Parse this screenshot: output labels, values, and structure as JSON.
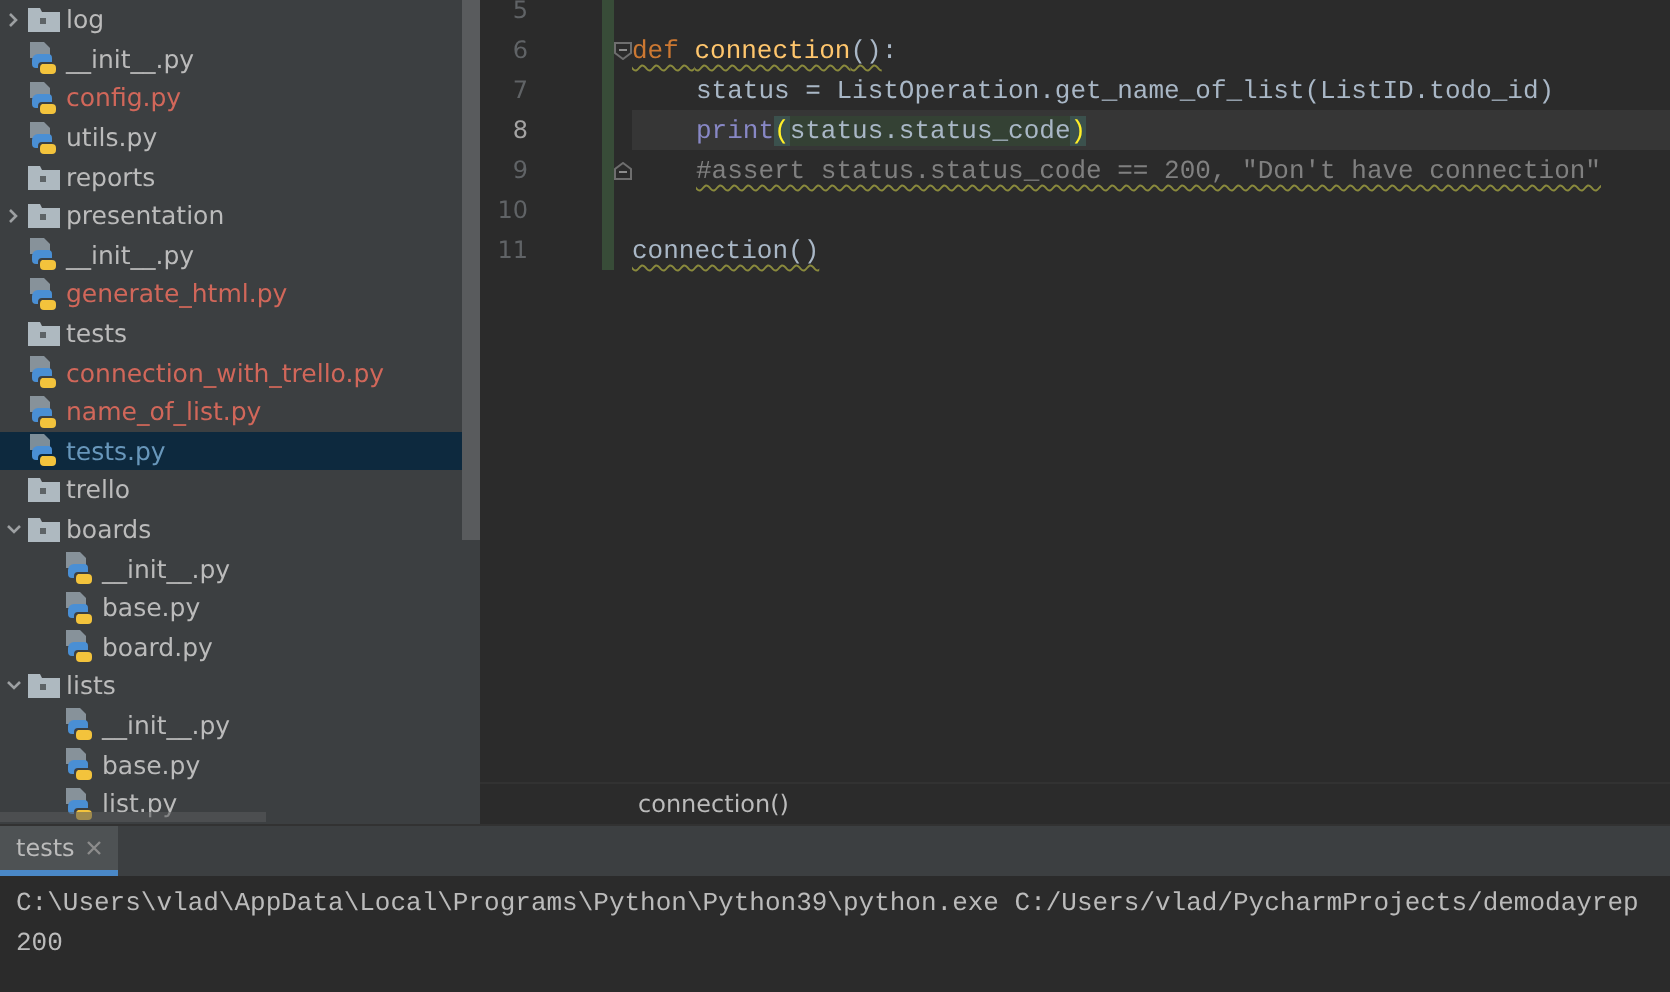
{
  "tree": {
    "items": [
      {
        "children": [
          {
            "label": "log",
            "kind": "folder",
            "expanded": false,
            "selected": false,
            "color": "#bbbbbb"
          },
          {
            "label": "__init__.py",
            "kind": "python",
            "selected": false,
            "color": "#bbbbbb"
          },
          {
            "label": "config.py",
            "kind": "python",
            "selected": false,
            "color": "#d1675a"
          },
          {
            "label": "utils.py",
            "kind": "python",
            "selected": false,
            "color": "#bbbbbb"
          }
        ]
      },
      {
        "label": "reports",
        "kind": "folder",
        "selected": false,
        "color": "#bbbbbb",
        "children": [
          {
            "label": "presentation",
            "kind": "folder",
            "expanded": false,
            "selected": false,
            "color": "#bbbbbb"
          },
          {
            "label": "__init__.py",
            "kind": "python",
            "selected": false,
            "color": "#bbbbbb"
          },
          {
            "label": "generate_html.py",
            "kind": "python",
            "selected": false,
            "color": "#d1675a"
          }
        ]
      },
      {
        "label": "tests",
        "kind": "folder",
        "selected": false,
        "color": "#bbbbbb",
        "children": [
          {
            "label": "connection_with_trello.py",
            "kind": "python",
            "selected": false,
            "color": "#d1675a"
          },
          {
            "label": "name_of_list.py",
            "kind": "python",
            "selected": false,
            "color": "#d1675a"
          },
          {
            "label": "tests.py",
            "kind": "python",
            "selected": true,
            "color": "#6897bb"
          }
        ]
      },
      {
        "label": "trello",
        "kind": "folder",
        "selected": false,
        "color": "#bbbbbb",
        "children": [
          {
            "label": "boards",
            "kind": "folder",
            "expanded": true,
            "selected": false,
            "color": "#bbbbbb",
            "children": [
              {
                "label": "__init__.py",
                "kind": "python",
                "selected": false,
                "color": "#bbbbbb"
              },
              {
                "label": "base.py",
                "kind": "python",
                "selected": false,
                "color": "#bbbbbb"
              },
              {
                "label": "board.py",
                "kind": "python",
                "selected": false,
                "color": "#bbbbbb"
              }
            ]
          },
          {
            "label": "lists",
            "kind": "folder",
            "expanded": true,
            "selected": false,
            "color": "#bbbbbb",
            "children": [
              {
                "label": "__init__.py",
                "kind": "python",
                "selected": false,
                "color": "#bbbbbb"
              },
              {
                "label": "base.py",
                "kind": "python",
                "selected": false,
                "color": "#bbbbbb"
              },
              {
                "label": "list.py",
                "kind": "python",
                "selected": false,
                "color": "#bbbbbb"
              }
            ]
          }
        ]
      }
    ]
  },
  "editor": {
    "lines": [
      {
        "number": "5",
        "current": false,
        "changed": true
      },
      {
        "number": "6",
        "current": false,
        "changed": true,
        "fold": {
          "kind": "open"
        },
        "indented": false,
        "tokens": [
          {
            "text": "def ",
            "kind": "keyword",
            "warn": true
          },
          {
            "text": "connection",
            "kind": "function",
            "warn": true
          },
          {
            "text": "()",
            "kind": "plain",
            "warn": true
          },
          {
            "text": ":",
            "kind": "plain",
            "warn": false
          }
        ]
      },
      {
        "number": "7",
        "current": false,
        "changed": true,
        "indented": true,
        "tokens": [
          {
            "text": "status = ListOperation.get_name_of_list(ListID.todo_id)",
            "kind": "plain",
            "warn": false
          }
        ]
      },
      {
        "number": "8",
        "current": true,
        "changed": true,
        "indented": true,
        "tokens": [
          {
            "text": "print",
            "kind": "builtin",
            "warn": false
          },
          {
            "text": "(",
            "kind": "paren",
            "warn": false
          },
          {
            "text": "status.status_code",
            "kind": "usage",
            "warn": false
          },
          {
            "text": ")",
            "kind": "paren",
            "warn": false
          }
        ]
      },
      {
        "number": "9",
        "current": false,
        "changed": true,
        "fold": {
          "kind": "close"
        },
        "indented": true,
        "tokens": [
          {
            "text": "#assert status.status_code == 200, \"Don't have connection\"",
            "kind": "comment",
            "warn": true
          }
        ]
      },
      {
        "number": "10",
        "current": false,
        "changed": true
      },
      {
        "number": "11",
        "current": false,
        "changed": true,
        "indented": false,
        "tokens": [
          {
            "text": "connection()",
            "kind": "plain",
            "warn": true
          }
        ]
      }
    ],
    "breadcrumb": "connection()"
  },
  "run_panel": {
    "tabs": [
      {
        "label": "tests",
        "selected": true
      }
    ],
    "output": [
      "C:\\Users\\vlad\\AppData\\Local\\Programs\\Python\\Python39\\python.exe C:/Users/vlad/PycharmProjects/demodayrep",
      "200"
    ]
  }
}
